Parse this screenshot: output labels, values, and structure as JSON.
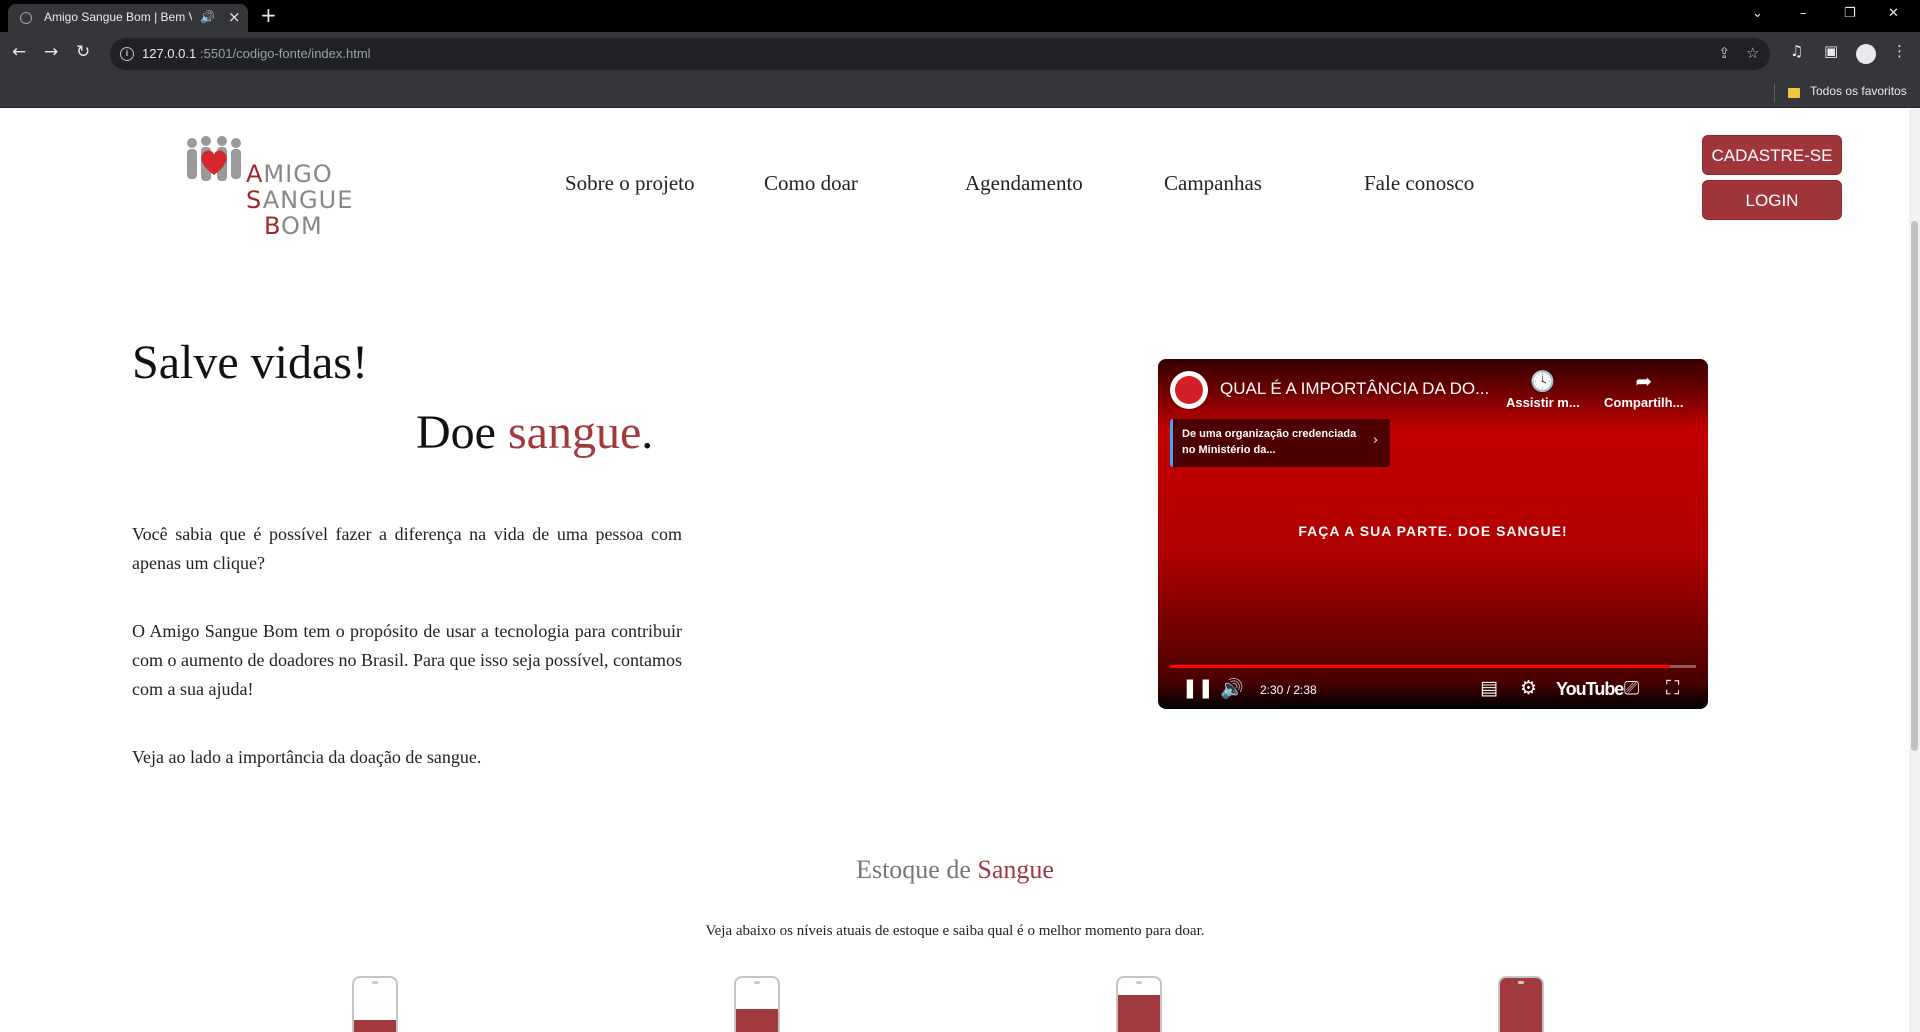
{
  "browser": {
    "tab_title": "Amigo Sangue Bom | Bem V",
    "url_host": "127.0.0.1",
    "url_rest": ":5501/codigo-fonte/index.html",
    "bookmark_label": "Todos os favoritos"
  },
  "site": {
    "logo_lines": [
      "AMIGO",
      "SANGUE",
      "BOM"
    ],
    "nav": [
      "Sobre o projeto",
      "Como doar",
      "Agendamento",
      "Campanhas",
      "Fale conosco"
    ],
    "signup_label": "CADASTRE-SE",
    "login_label": "LOGIN"
  },
  "hero": {
    "title": "Salve vidas!",
    "subtitle_prefix": "Doe ",
    "subtitle_highlight": "sangue",
    "subtitle_suffix": ".",
    "paragraphs": [
      "Você sabia que é possível fazer a diferença na vida de uma pessoa com apenas um clique?",
      "O Amigo Sangue Bom tem o propósito de usar a tecnologia para contribuir com o aumento de doadores no Brasil. Para que isso seja possível, contamos com a sua ajuda!",
      "Veja ao lado a importância da doação de sangue."
    ]
  },
  "video": {
    "title": "QUAL É A IMPORTÂNCIA DA DO...",
    "watch_later": "Assistir m...",
    "share": "Compartilh...",
    "credential": "De uma organização credenciada no Ministério da...",
    "center_text": "FAÇA A SUA PARTE. DOE SANGUE!",
    "time": "2:30 / 2:38",
    "progress": 0.95,
    "logo": "YouTube"
  },
  "stock": {
    "title_prefix": "Estoque de ",
    "title_highlight": "Sangue",
    "description": "Veja abaixo os níveis atuais de estoque e saiba qual é o melhor momento para doar.",
    "levels": [
      0.25,
      0.45,
      0.7,
      1.0
    ]
  },
  "colors": {
    "brand_red": "#a03a3e",
    "video_red": "#c40000"
  }
}
